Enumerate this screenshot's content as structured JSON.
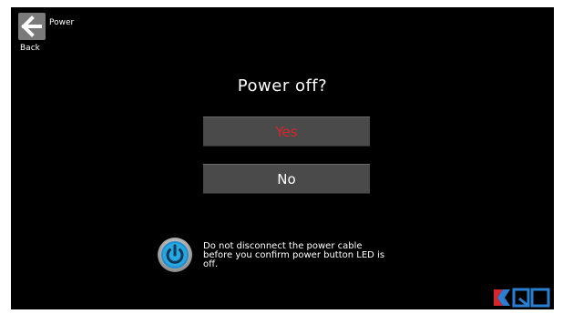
{
  "screen": {
    "title": "Power",
    "back_label": "Back"
  },
  "dialog": {
    "title": "Power off?",
    "yes_label": "Yes",
    "no_label": "No",
    "note": "Do not disconnect the power cable\nbefore you confirm power button LED is\noff."
  },
  "icons": {
    "back": "back-arrow-icon",
    "power": "power-icon",
    "logo": "ro-logo"
  },
  "colors": {
    "background": "#000000",
    "button": "#4a4a4a",
    "yes_text": "#d6262b",
    "no_text": "#ffffff",
    "power_icon": "#2aa6e0"
  }
}
